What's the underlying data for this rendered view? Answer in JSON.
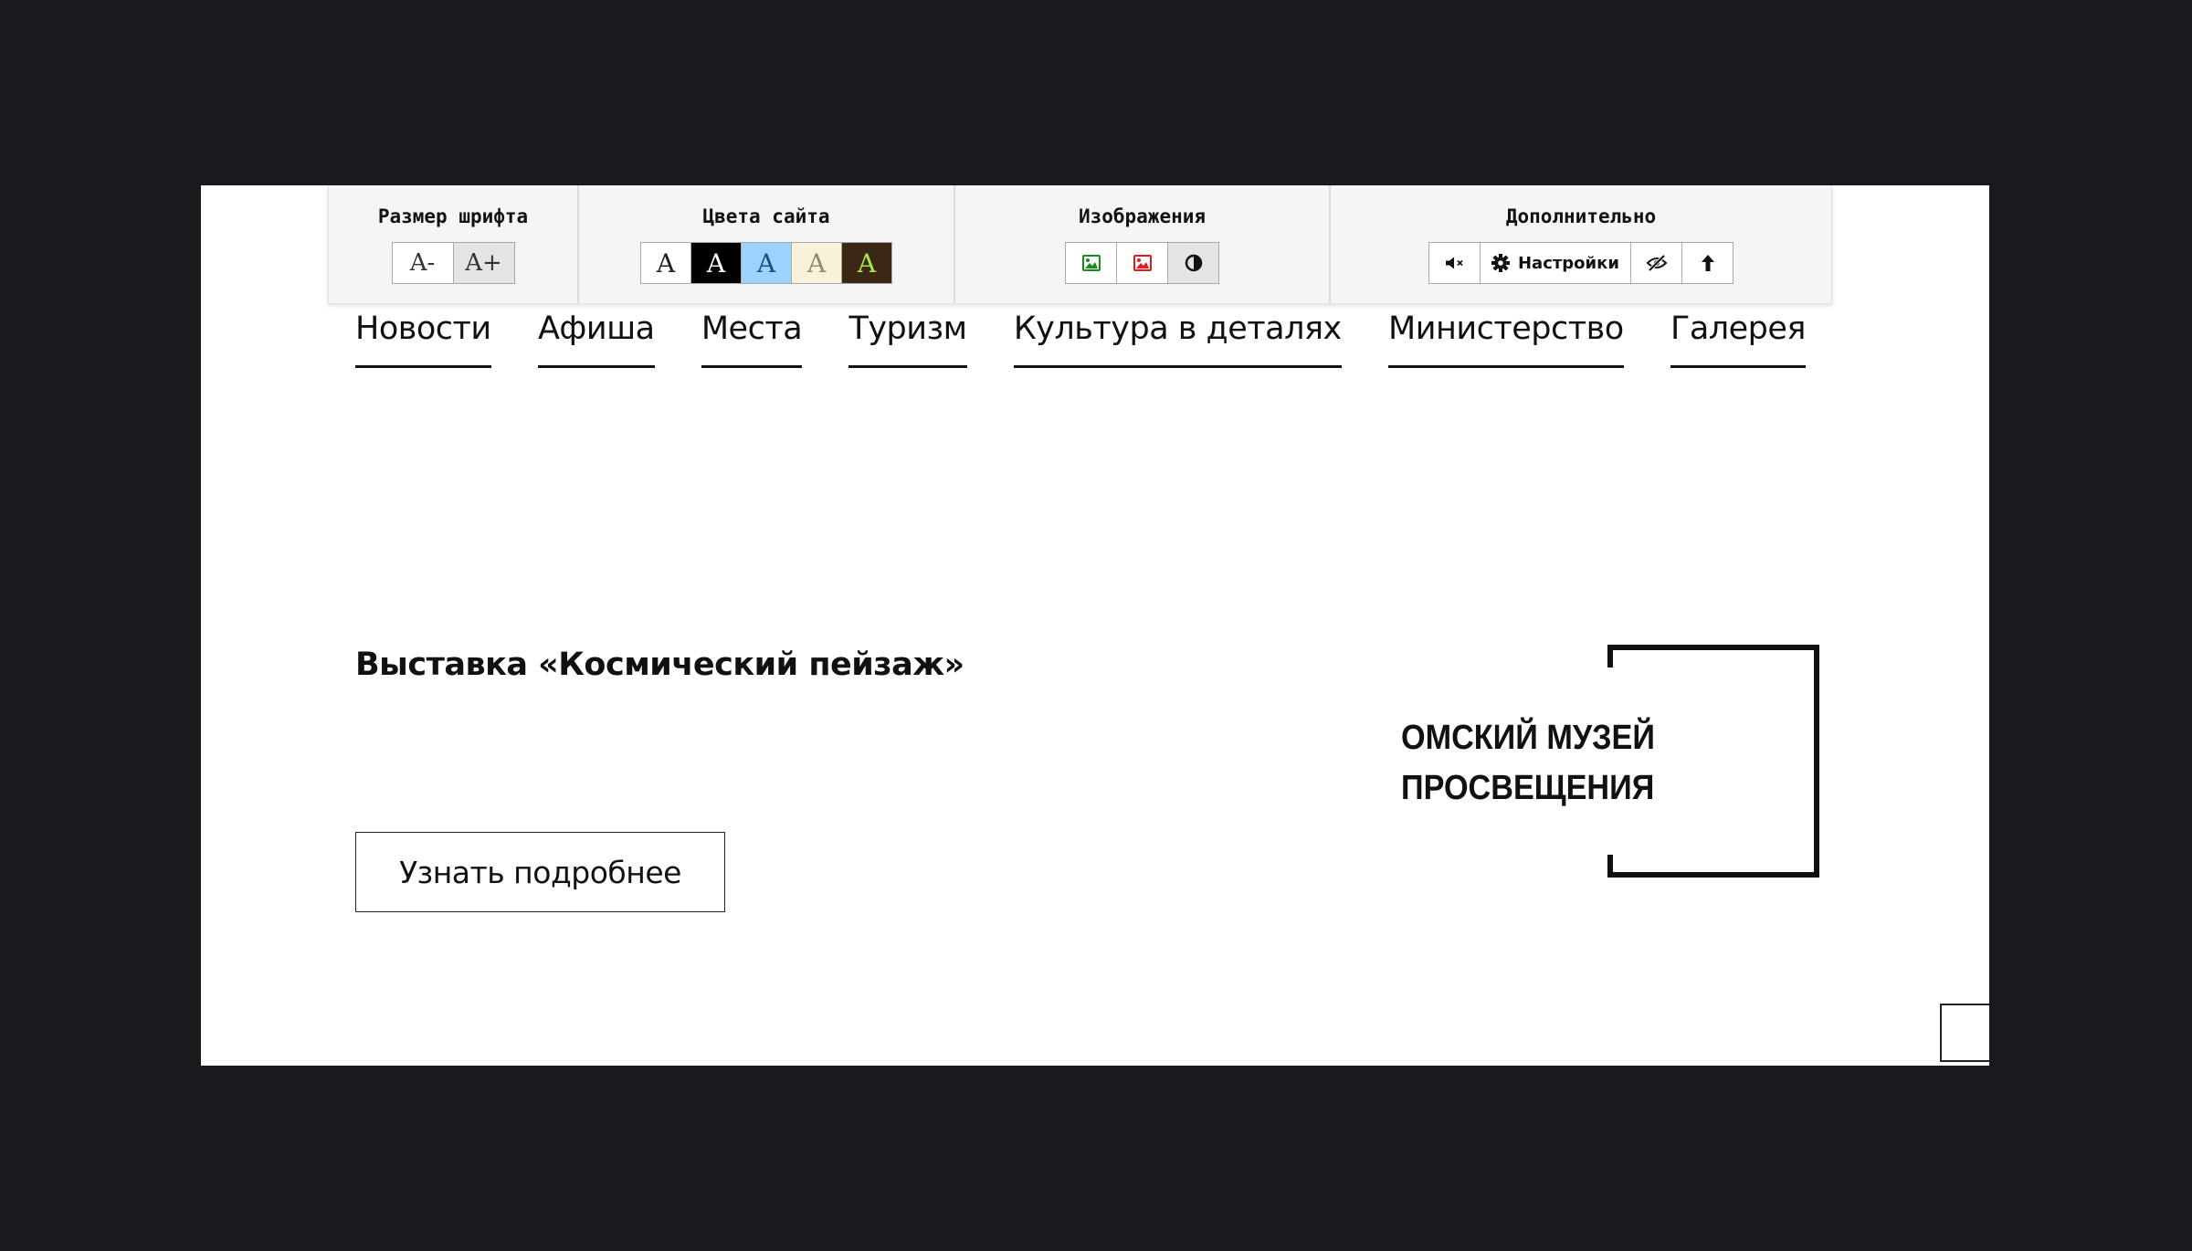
{
  "a11y_panel": {
    "font_size": {
      "title": "Размер шрифта",
      "decrease": "A-",
      "increase": "A+"
    },
    "colors": {
      "title": "Цвета сайта",
      "schemes": [
        {
          "label": "A",
          "bg": "#ffffff",
          "fg": "#222222"
        },
        {
          "label": "A",
          "bg": "#000000",
          "fg": "#ffffff"
        },
        {
          "label": "A",
          "bg": "#9dd1ff",
          "fg": "#195183"
        },
        {
          "label": "A",
          "bg": "#f7f3d6",
          "fg": "#918b73"
        },
        {
          "label": "A",
          "bg": "#3b2716",
          "fg": "#a9e44d"
        }
      ]
    },
    "images": {
      "title": "Изображения",
      "buttons": [
        "image-on-icon",
        "image-off-icon",
        "contrast-icon"
      ]
    },
    "extra": {
      "title": "Дополнительно",
      "settings_label": "Настройки"
    }
  },
  "nav": {
    "items": [
      "Новости",
      "Афиша",
      "Места",
      "Туризм",
      "Культура в деталях",
      "Министерство",
      "Галерея"
    ]
  },
  "event": {
    "title": "Выставка «Космический пейзаж»",
    "button": "Узнать подробнее",
    "venue_line1": "ОМСКИЙ МУЗЕЙ",
    "venue_line2": "ПРОСВЕЩЕНИЯ"
  }
}
